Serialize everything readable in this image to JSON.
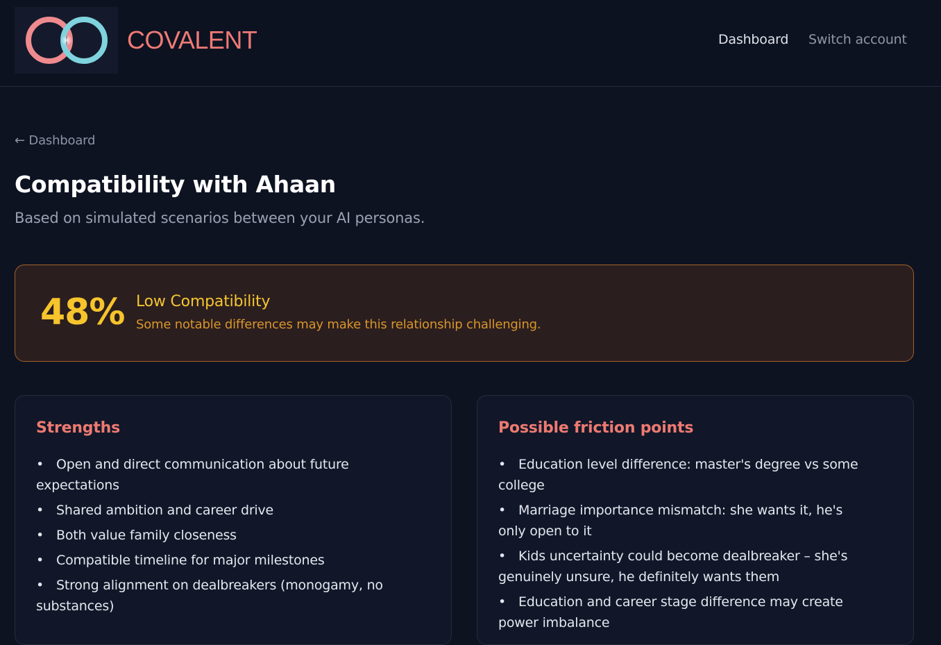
{
  "header": {
    "brand": "COVALENT",
    "nav": {
      "dashboard": "Dashboard",
      "switch_account": "Switch account"
    }
  },
  "breadcrumb": {
    "back_label": "← Dashboard"
  },
  "page": {
    "title": "Compatibility with Ahaan",
    "subtitle": "Based on simulated scenarios between your AI personas."
  },
  "score": {
    "value": "48%",
    "level": "Low Compatibility",
    "description": "Some notable differences may make this relationship challenging."
  },
  "strengths": {
    "title": "Strengths",
    "items": [
      "Open and direct communication about future expectations",
      "Shared ambition and career drive",
      "Both value family closeness",
      "Compatible timeline for major milestones",
      "Strong alignment on dealbreakers (monogamy, no substances)"
    ]
  },
  "friction": {
    "title": "Possible friction points",
    "items": [
      "Education level difference: master's degree vs some college",
      "Marriage importance mismatch: she wants it, he's only open to it",
      "Kids uncertainty could become dealbreaker – she's genuinely unsure, he definitely wants them",
      "Education and career stage difference may create power imbalance"
    ]
  },
  "colors": {
    "brand": "#ef7b75",
    "score_accent": "#f6c42c",
    "score_border": "#a3612a",
    "panel_title": "#ee7a71"
  }
}
